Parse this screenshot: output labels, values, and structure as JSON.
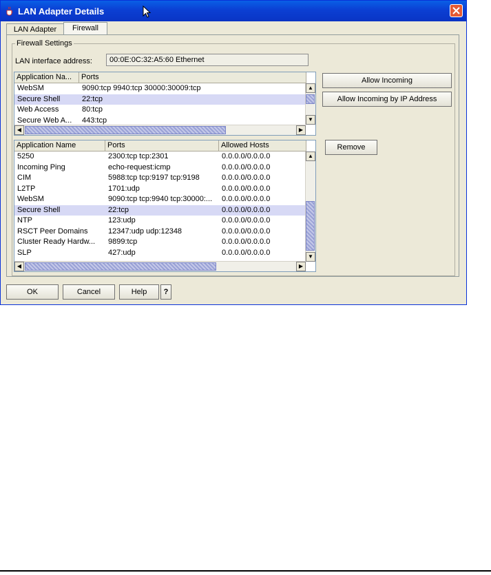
{
  "window": {
    "title": "LAN Adapter Details"
  },
  "tabs": [
    {
      "label": "LAN Adapter"
    },
    {
      "label": "Firewall"
    }
  ],
  "firewall": {
    "group_label": "Firewall Settings",
    "lan_label": "LAN interface address:",
    "lan_value": "00:0E:0C:32:A5:60 Ethernet"
  },
  "top_table": {
    "headers": [
      "Application Na...",
      "Ports"
    ],
    "rows": [
      [
        "WebSM",
        "9090:tcp 9940:tcp 30000:30009:tcp"
      ],
      [
        "Secure Shell",
        "22:tcp"
      ],
      [
        "Web Access",
        "80:tcp"
      ],
      [
        "Secure Web A...",
        "443:tcp"
      ]
    ],
    "selected_index": 1
  },
  "bottom_table": {
    "headers": [
      "Application Name",
      "Ports",
      "Allowed Hosts"
    ],
    "rows": [
      [
        "5250",
        "2300:tcp tcp:2301",
        "0.0.0.0/0.0.0.0"
      ],
      [
        "Incoming Ping",
        "echo-request:icmp",
        "0.0.0.0/0.0.0.0"
      ],
      [
        "CIM",
        "5988:tcp tcp:9197 tcp:9198",
        "0.0.0.0/0.0.0.0"
      ],
      [
        "L2TP",
        "1701:udp",
        "0.0.0.0/0.0.0.0"
      ],
      [
        "WebSM",
        "9090:tcp tcp:9940 tcp:30000:...",
        "0.0.0.0/0.0.0.0"
      ],
      [
        "Secure Shell",
        "22:tcp",
        "0.0.0.0/0.0.0.0"
      ],
      [
        "NTP",
        "123:udp",
        "0.0.0.0/0.0.0.0"
      ],
      [
        "RSCT Peer Domains",
        "12347:udp udp:12348",
        "0.0.0.0/0.0.0.0"
      ],
      [
        "Cluster Ready Hardw...",
        "9899:tcp",
        "0.0.0.0/0.0.0.0"
      ],
      [
        "SLP",
        "427:udp",
        "0.0.0.0/0.0.0.0"
      ]
    ],
    "selected_index": 5
  },
  "buttons": {
    "allow_incoming": "Allow Incoming",
    "allow_incoming_ip": "Allow Incoming by IP Address",
    "remove": "Remove",
    "ok": "OK",
    "cancel": "Cancel",
    "help": "Help",
    "question": "?"
  },
  "icons": {
    "title": "java-cup-icon",
    "close": "close-icon",
    "cursor": "mouse-pointer-icon"
  },
  "colors": {
    "titlebar": "#0b3fd3",
    "selected_row": "#d7d9f5",
    "close_button": "#e45a34"
  }
}
